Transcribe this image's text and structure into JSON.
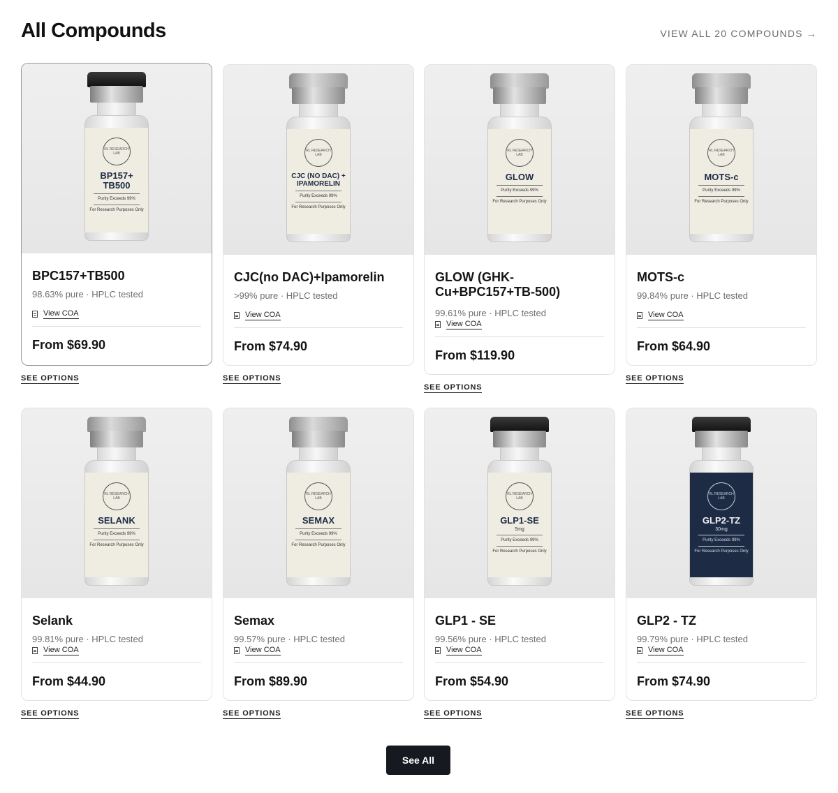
{
  "header": {
    "title": "All Compounds",
    "view_all_label": "VIEW ALL 20 COMPOUNDS →"
  },
  "vial_label_text": {
    "seal": "RL RESEARCH LAB",
    "purity_line": "Purity Exceeds 99%",
    "research_line": "For Research Purposes Only"
  },
  "products": [
    {
      "name": "BPC157+TB500",
      "meta": "98.63% pure · HPLC tested",
      "coa": "View COA",
      "price": "From $69.90",
      "cta": "SEE OPTIONS",
      "vial_label": "BP157+ TB500",
      "cap": "dark",
      "label_color": "cream"
    },
    {
      "name": "CJC(no DAC)+Ipamorelin",
      "meta": ">99% pure · HPLC tested",
      "coa": "View COA",
      "price": "From $74.90",
      "cta": "SEE OPTIONS",
      "vial_label": "CJC (NO DAC) + IPAMORELIN",
      "cap": "silver",
      "label_color": "cream"
    },
    {
      "name": "GLOW (GHK-Cu+BPC157+TB-500)",
      "meta": "99.61% pure · HPLC tested",
      "coa": "View COA",
      "price": "From $119.90",
      "cta": "SEE OPTIONS",
      "vial_label": "GLOW",
      "cap": "silver",
      "label_color": "cream"
    },
    {
      "name": "MOTS-c",
      "meta": "99.84% pure · HPLC tested",
      "coa": "View COA",
      "price": "From $64.90",
      "cta": "SEE OPTIONS",
      "vial_label": "MOTS-c",
      "cap": "silver",
      "label_color": "cream"
    },
    {
      "name": "Selank",
      "meta": "99.81% pure · HPLC tested",
      "coa": "View COA",
      "price": "From $44.90",
      "cta": "SEE OPTIONS",
      "vial_label": "SELANK",
      "cap": "silver",
      "label_color": "cream"
    },
    {
      "name": "Semax",
      "meta": "99.57% pure · HPLC tested",
      "coa": "View COA",
      "price": "From $89.90",
      "cta": "SEE OPTIONS",
      "vial_label": "SEMAX",
      "cap": "silver",
      "label_color": "cream"
    },
    {
      "name": "GLP1 - SE",
      "meta": "99.56% pure · HPLC tested",
      "coa": "View COA",
      "price": "From $54.90",
      "cta": "SEE OPTIONS",
      "vial_label": "GLP1-SE",
      "vial_dose": "5mg",
      "cap": "dark",
      "label_color": "cream"
    },
    {
      "name": "GLP2 - TZ",
      "meta": "99.79% pure · HPLC tested",
      "coa": "View COA",
      "price": "From $74.90",
      "cta": "SEE OPTIONS",
      "vial_label": "GLP2-TZ",
      "vial_dose": "30mg",
      "cap": "dark",
      "label_color": "navy"
    }
  ],
  "footer": {
    "see_all_label": "See All"
  }
}
